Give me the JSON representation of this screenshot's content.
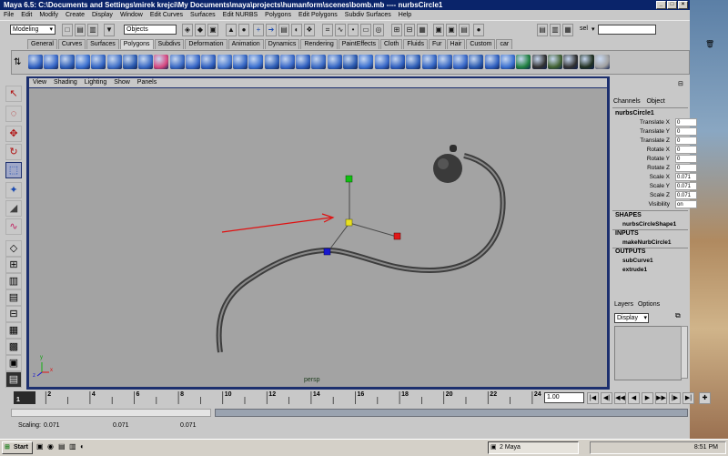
{
  "window": {
    "title": "Maya 6.5: C:\\Documents and Settings\\mirek krejci\\My Documents\\maya\\projects\\humanform\\scenes\\bomb.mb  ----  nurbsCircle1"
  },
  "menu": [
    "File",
    "Edit",
    "Modify",
    "Create",
    "Display",
    "Window",
    "Edit Curves",
    "Surfaces",
    "Edit NURBS",
    "Polygons",
    "Edit Polygons",
    "Subdiv Surfaces",
    "Help"
  ],
  "statusline": {
    "mode": "Modeling",
    "select_mode": "Objects",
    "sel_label": "sel"
  },
  "shelf_tabs": [
    "General",
    "Curves",
    "Surfaces",
    "Polygons",
    "Subdivs",
    "Deformation",
    "Animation",
    "Dynamics",
    "Rendering",
    "PaintEffects",
    "Cloth",
    "Fluids",
    "Fur",
    "Hair",
    "Custom",
    "car"
  ],
  "shelf_active": "Polygons",
  "panel_menu": [
    "View",
    "Shading",
    "Lighting",
    "Show",
    "Panels"
  ],
  "viewport": {
    "camera": "persp",
    "axis_y": "y",
    "axis_x": "x",
    "axis_z": "z"
  },
  "channelbox": {
    "tabs": [
      "Channels",
      "Object"
    ],
    "node": "nurbsCircle1",
    "channels": [
      {
        "name": "Translate X",
        "value": "0"
      },
      {
        "name": "Translate Y",
        "value": "0"
      },
      {
        "name": "Translate Z",
        "value": "0"
      },
      {
        "name": "Rotate X",
        "value": "0"
      },
      {
        "name": "Rotate Y",
        "value": "0"
      },
      {
        "name": "Rotate Z",
        "value": "0"
      },
      {
        "name": "Scale X",
        "value": "0.071"
      },
      {
        "name": "Scale Y",
        "value": "0.071"
      },
      {
        "name": "Scale Z",
        "value": "0.071"
      },
      {
        "name": "Visibility",
        "value": "on"
      }
    ],
    "shapes_header": "SHAPES",
    "shape": "nurbsCircleShape1",
    "inputs_header": "INPUTS",
    "input": "makeNurbCircle1",
    "outputs_header": "OUTPUTS",
    "outputs": [
      "subCurve1",
      "extrude1"
    ]
  },
  "layers": {
    "tabs": [
      "Layers",
      "Options"
    ],
    "display": "Display"
  },
  "timeline": {
    "ticks": [
      "1",
      "2",
      "4",
      "6",
      "8",
      "10",
      "12",
      "14",
      "16",
      "18",
      "20",
      "22",
      "24"
    ],
    "current_frame": "1",
    "current_time_field": "1.00"
  },
  "status": {
    "label": "Scaling:",
    "values": [
      "0.071",
      "0.071",
      "0.071"
    ]
  },
  "taskbar": {
    "start": "Start",
    "item": "2 Maya",
    "time": "8:51 PM"
  },
  "colors": {
    "viewport_bg": "#a3a3a3",
    "panel_border": "#1c2f6e",
    "title_bar": "#0a246a",
    "arrow": "#e01010"
  }
}
